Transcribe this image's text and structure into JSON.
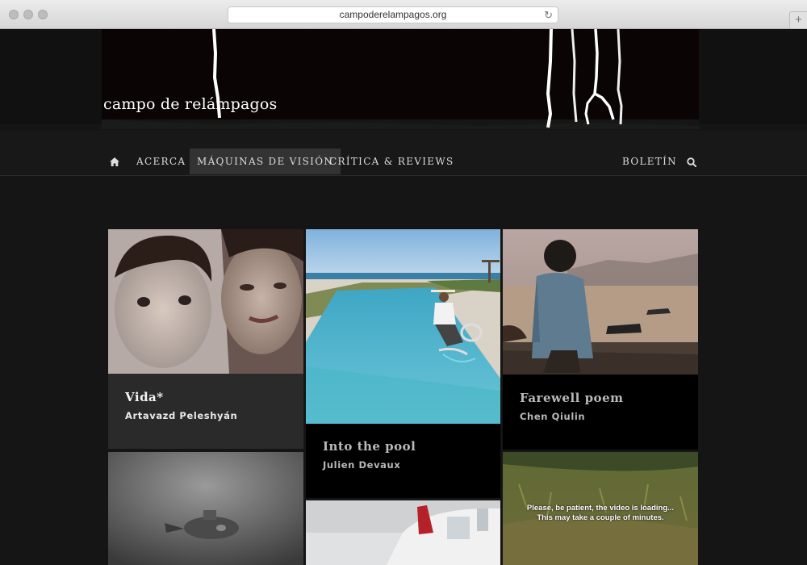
{
  "browser": {
    "url": "campoderelampagos.org",
    "new_tab_label": "+"
  },
  "site": {
    "title": "campo de relámpagos"
  },
  "nav": {
    "home_label": "home",
    "items": [
      {
        "label": "ACERCA"
      },
      {
        "label": "MÁQUINAS DE VISIÓN",
        "active": true
      },
      {
        "label": "CRÍTICA & REVIEWS"
      }
    ],
    "newsletter_label": "BOLETÍN"
  },
  "cards": [
    {
      "title": "Vida*",
      "author": "Artavazd Peleshyán"
    },
    {
      "title": "Into the pool",
      "author": "Julien Devaux"
    },
    {
      "title": "Farewell poem",
      "author": "Chen Qiulin"
    }
  ],
  "loading": {
    "line1": "Please, be patient, the video is loading...",
    "line2": "This may take a couple of minutes."
  },
  "colors": {
    "page_bg": "#151515",
    "nav_active_bg": "#333333",
    "card_bg": "#000000",
    "card_highlight_bg": "#2a2a2a"
  }
}
